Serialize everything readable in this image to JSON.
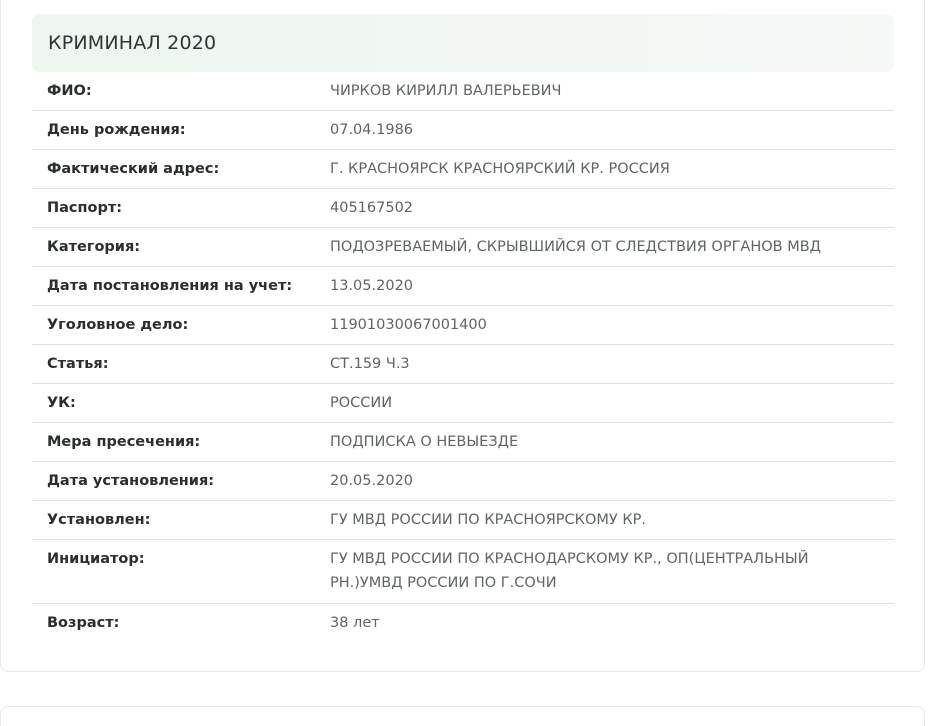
{
  "card": {
    "title": "КРИМИНАЛ 2020",
    "rows": [
      {
        "label": "ФИО:",
        "value": "ЧИРКОВ КИРИЛЛ ВАЛЕРЬЕВИЧ"
      },
      {
        "label": "День рождения:",
        "value": "07.04.1986"
      },
      {
        "label": "Фактический адрес:",
        "value": "Г. КРАСНОЯРСК КРАСНОЯРСКИЙ КР. РОССИЯ"
      },
      {
        "label": "Паспорт:",
        "value": "405167502"
      },
      {
        "label": "Категория:",
        "value": "ПОДОЗРЕВАЕМЫЙ, СКРЫВШИЙСЯ ОТ СЛЕДСТВИЯ ОРГАНОВ МВД"
      },
      {
        "label": "Дата постановления на учет:",
        "value": "13.05.2020"
      },
      {
        "label": "Уголовное дело:",
        "value": "11901030067001400"
      },
      {
        "label": "Статья:",
        "value": "СТ.159 Ч.3"
      },
      {
        "label": "УК:",
        "value": "РОССИИ"
      },
      {
        "label": "Мера пресечения:",
        "value": "ПОДПИСКА О НЕВЫЕЗДЕ"
      },
      {
        "label": "Дата установления:",
        "value": "20.05.2020"
      },
      {
        "label": "Установлен:",
        "value": "ГУ МВД РОССИИ ПО КРАСНОЯРСКОМУ КР."
      },
      {
        "label": "Инициатор:",
        "value": "ГУ МВД РОССИИ ПО КРАСНОДАРСКОМУ КР., ОП(ЦЕНТРАЛЬНЫЙ РН.)УМВД РОССИИ ПО Г.СОЧИ"
      },
      {
        "label": "Возраст:",
        "value": "38 лет"
      }
    ]
  }
}
